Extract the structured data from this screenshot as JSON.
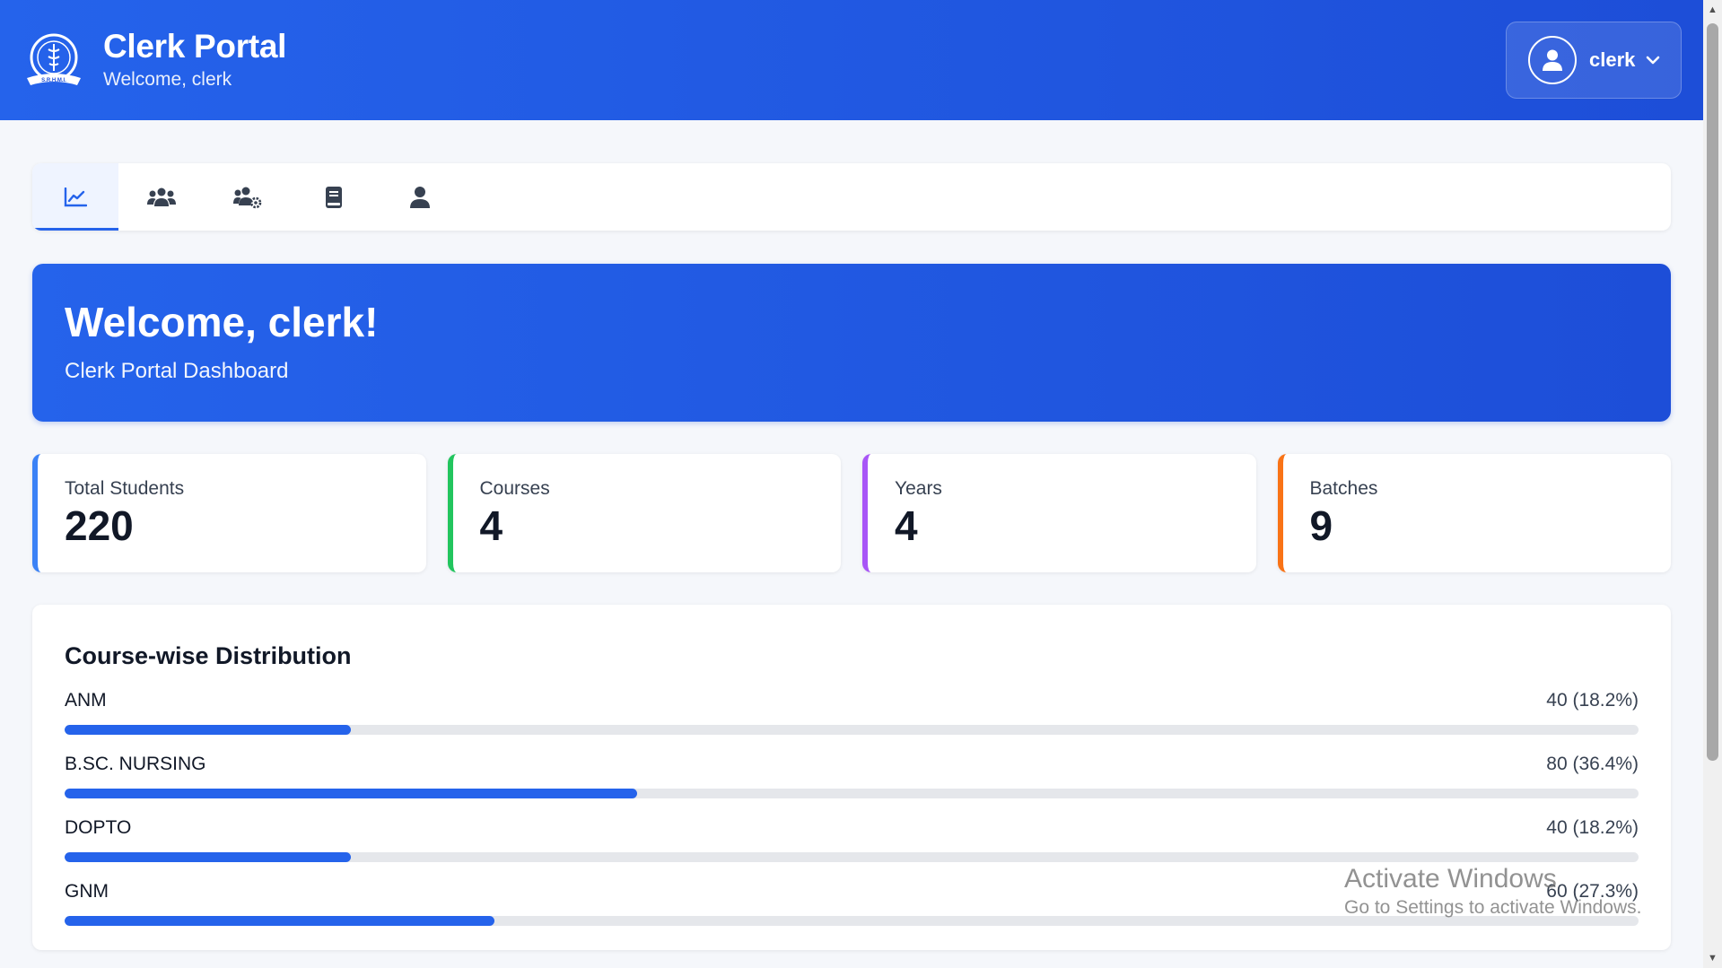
{
  "header": {
    "title": "Clerk Portal",
    "subtitle": "Welcome, clerk",
    "logo_text": "S.R.H.M.I.",
    "user": {
      "name": "clerk"
    }
  },
  "tabs": [
    {
      "icon": "chart-line-icon",
      "active": true
    },
    {
      "icon": "users-icon",
      "active": false
    },
    {
      "icon": "users-cog-icon",
      "active": false
    },
    {
      "icon": "book-icon",
      "active": false
    },
    {
      "icon": "user-icon",
      "active": false
    }
  ],
  "banner": {
    "title": "Welcome, clerk!",
    "subtitle": "Clerk Portal Dashboard"
  },
  "stats": [
    {
      "label": "Total Students",
      "value": "220",
      "color": "#3b82f6"
    },
    {
      "label": "Courses",
      "value": "4",
      "color": "#22c55e"
    },
    {
      "label": "Years",
      "value": "4",
      "color": "#a855f7"
    },
    {
      "label": "Batches",
      "value": "9",
      "color": "#f97316"
    }
  ],
  "distribution": {
    "title": "Course-wise Distribution",
    "items": [
      {
        "label": "ANM",
        "display": "40 (18.2%)",
        "percent": 18.2
      },
      {
        "label": "B.SC. NURSING",
        "display": "80 (36.4%)",
        "percent": 36.4
      },
      {
        "label": "DOPTO",
        "display": "40 (18.2%)",
        "percent": 18.2
      },
      {
        "label": "GNM",
        "display": "60 (27.3%)",
        "percent": 27.3
      }
    ]
  },
  "watermark": {
    "title": "Activate Windows",
    "subtitle": "Go to Settings to activate Windows."
  },
  "colors": {
    "primary": "#2563eb",
    "primary_dark": "#1d4ed8",
    "track": "#e5e7eb"
  }
}
